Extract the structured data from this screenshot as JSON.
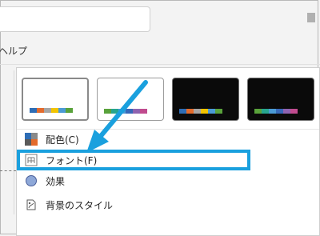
{
  "top_menu": {
    "help_label_partial": "ヘルプ"
  },
  "gallery": {
    "themes": [
      {
        "style": "light",
        "selected": true,
        "swatches": [
          "#2e6db5",
          "#e36b2c",
          "#a5a5a5",
          "#f2c400",
          "#4b9ad5",
          "#59a23b"
        ]
      },
      {
        "style": "light",
        "selected": false,
        "swatches": [
          "#59a23b",
          "#27a58f",
          "#4b9ad5",
          "#3768b8",
          "#8f63b0",
          "#c04b8e"
        ]
      },
      {
        "style": "dark",
        "selected": false,
        "swatches": [
          "#2e6db5",
          "#e36b2c",
          "#a5a5a5",
          "#f2c400",
          "#4b9ad5",
          "#59a23b"
        ]
      },
      {
        "style": "dark",
        "selected": false,
        "swatches": [
          "#59a23b",
          "#27a58f",
          "#4b9ad5",
          "#3768b8",
          "#8f63b0",
          "#c04b8e"
        ]
      }
    ]
  },
  "menu": {
    "items": [
      {
        "label": "配色(C)",
        "icon": "color-scheme-icon"
      },
      {
        "label": "フォント(F)",
        "icon": "font-icon",
        "highlighted": true
      },
      {
        "label": "効果",
        "icon": "effects-icon"
      },
      {
        "label": "背景のスタイル",
        "icon": "background-style-icon"
      }
    ]
  },
  "colors": {
    "highlight": "#1aa0de",
    "arrow": "#1aa0de"
  }
}
